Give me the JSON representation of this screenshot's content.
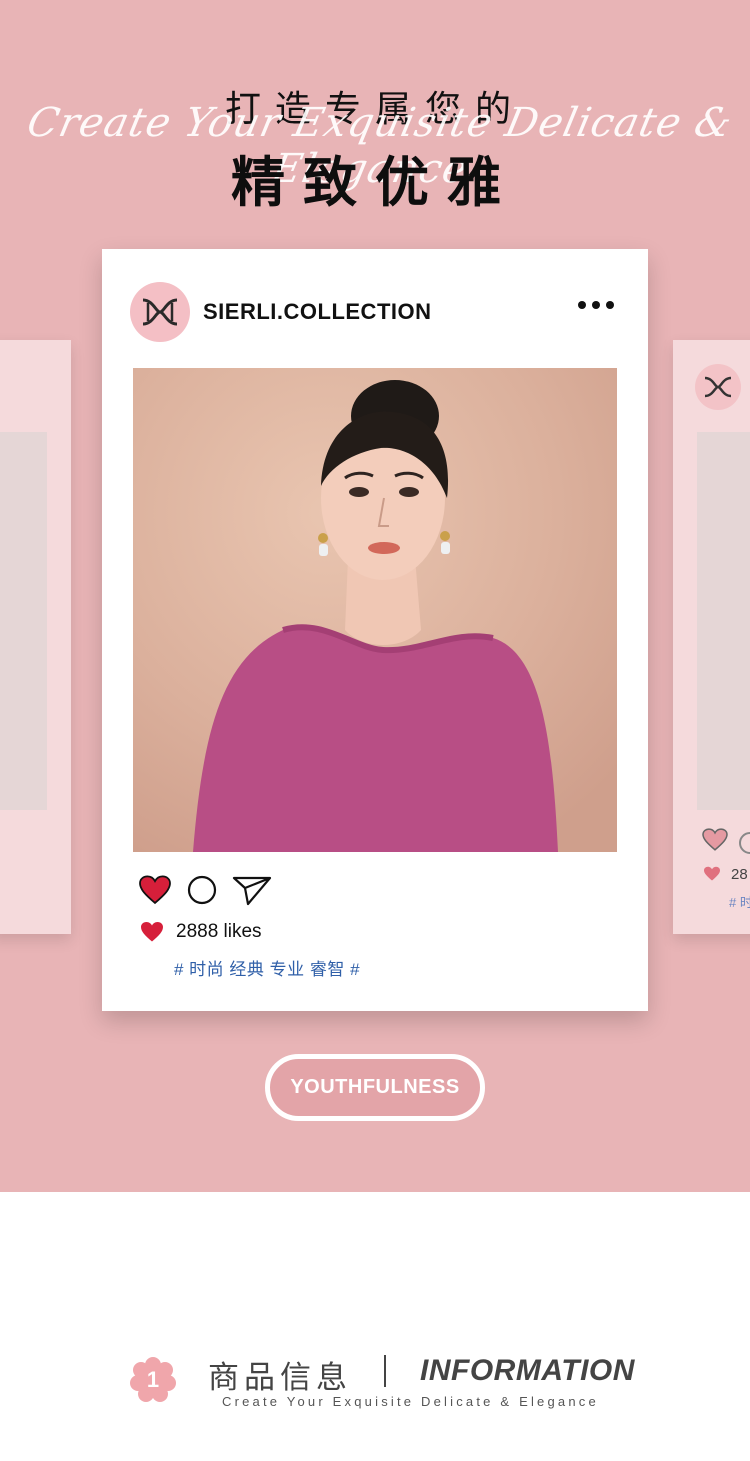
{
  "hero": {
    "title_line1": "打造专属您的",
    "script_text": "Create Your Exquisite Delicate & Elegance",
    "title_line2": "精致优雅",
    "background_color": "#e8b4b6"
  },
  "post": {
    "account_name": "SIERLI.COLLECTION",
    "avatar_icon": "sierli-logo-icon",
    "more_icon": "more-dots-icon",
    "photo_alt": "model wearing a magenta knit sweater",
    "actions": [
      "heart-icon",
      "comment-icon",
      "share-icon"
    ],
    "likes_text": "2888 likes",
    "tags_text": "# 时尚 经典 专业 睿智 #",
    "heart_color": "#d61f3a",
    "tag_color": "#2f5fa8"
  },
  "side_card_right": {
    "likes_partial": "28",
    "tag_partial": "# 时"
  },
  "cta": {
    "label": "YOUTHFULNESS"
  },
  "info": {
    "badge_number": "1",
    "title_cn": "商品信息",
    "title_en": "INFORMATION",
    "subtitle": "Create Your Exquisite Delicate & Elegance",
    "badge_color": "#f0a6ab"
  }
}
